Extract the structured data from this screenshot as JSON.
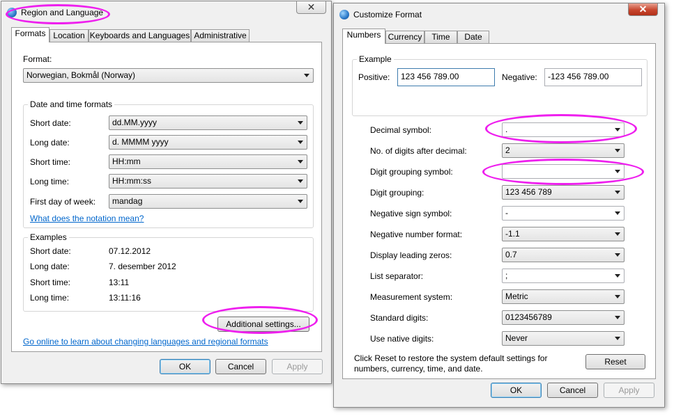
{
  "region_dialog": {
    "title": "Region and Language",
    "tabs": [
      "Formats",
      "Location",
      "Keyboards and Languages",
      "Administrative"
    ],
    "format_label": "Format:",
    "format_value": "Norwegian, Bokmål (Norway)",
    "date_time_group_title": "Date and time formats",
    "fields": [
      {
        "label": "Short date:",
        "value": "dd.MM.yyyy"
      },
      {
        "label": "Long date:",
        "value": "d. MMMM yyyy"
      },
      {
        "label": "Short time:",
        "value": "HH:mm"
      },
      {
        "label": "Long time:",
        "value": "HH:mm:ss"
      },
      {
        "label": "First day of week:",
        "value": "mandag"
      }
    ],
    "notation_link": "What does the notation mean?",
    "examples_group_title": "Examples",
    "examples": [
      {
        "label": "Short date:",
        "value": "07.12.2012"
      },
      {
        "label": "Long date:",
        "value": "7. desember 2012"
      },
      {
        "label": "Short time:",
        "value": "13:11"
      },
      {
        "label": "Long time:",
        "value": "13:11:16"
      }
    ],
    "additional_settings_label": "Additional settings...",
    "online_link": "Go online to learn about changing languages and regional formats",
    "ok_label": "OK",
    "cancel_label": "Cancel",
    "apply_label": "Apply"
  },
  "customize_dialog": {
    "title": "Customize Format",
    "tabs": [
      "Numbers",
      "Currency",
      "Time",
      "Date"
    ],
    "example_group_title": "Example",
    "positive_label": "Positive:",
    "positive_value": "123 456 789.00",
    "negative_label": "Negative:",
    "negative_value": "-123 456 789.00",
    "settings": [
      {
        "label": "Decimal symbol:",
        "value": "."
      },
      {
        "label": "No. of digits after decimal:",
        "value": "2"
      },
      {
        "label": "Digit grouping symbol:",
        "value": ""
      },
      {
        "label": "Digit grouping:",
        "value": "123 456 789"
      },
      {
        "label": "Negative sign symbol:",
        "value": "-"
      },
      {
        "label": "Negative number format:",
        "value": "-1.1"
      },
      {
        "label": "Display leading zeros:",
        "value": "0.7"
      },
      {
        "label": "List separator:",
        "value": ";"
      },
      {
        "label": "Measurement system:",
        "value": "Metric"
      },
      {
        "label": "Standard digits:",
        "value": "0123456789"
      },
      {
        "label": "Use native digits:",
        "value": "Never"
      }
    ],
    "reset_text": "Click Reset to restore the system default settings for numbers, currency, time, and date.",
    "reset_label": "Reset",
    "ok_label": "OK",
    "cancel_label": "Cancel",
    "apply_label": "Apply"
  },
  "annotation_color": "#ee1fee"
}
